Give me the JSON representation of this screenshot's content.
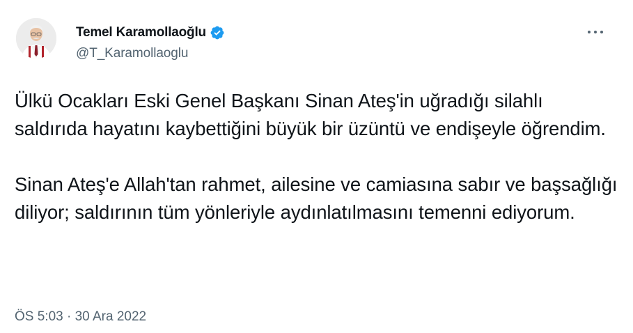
{
  "author": {
    "display_name": "Temel Karamollaoğlu",
    "handle": "@T_Karamollaoglu",
    "verified": true
  },
  "icons": {
    "avatar": "profile-photo",
    "verified": "verified-badge-icon",
    "more": "more-options-icon"
  },
  "colors": {
    "verified_blue": "#1d9bf0",
    "text": "#0f1419",
    "secondary_text": "#536471"
  },
  "tweet": {
    "paragraphs": [
      "Ülkü Ocakları Eski Genel Başkanı Sinan Ateş'in uğradığı silahlı saldırıda hayatını kaybettiğini büyük bir üzüntü ve endişeyle öğrendim.",
      "Sinan Ateş'e Allah'tan rahmet, ailesine ve camiasına sabır ve başsağlığı diliyor; saldırının tüm yönleriyle aydınlatılmasını temenni ediyorum."
    ]
  },
  "meta": {
    "time": "ÖS 5:03",
    "separator": "·",
    "date": "30 Ara 2022"
  }
}
